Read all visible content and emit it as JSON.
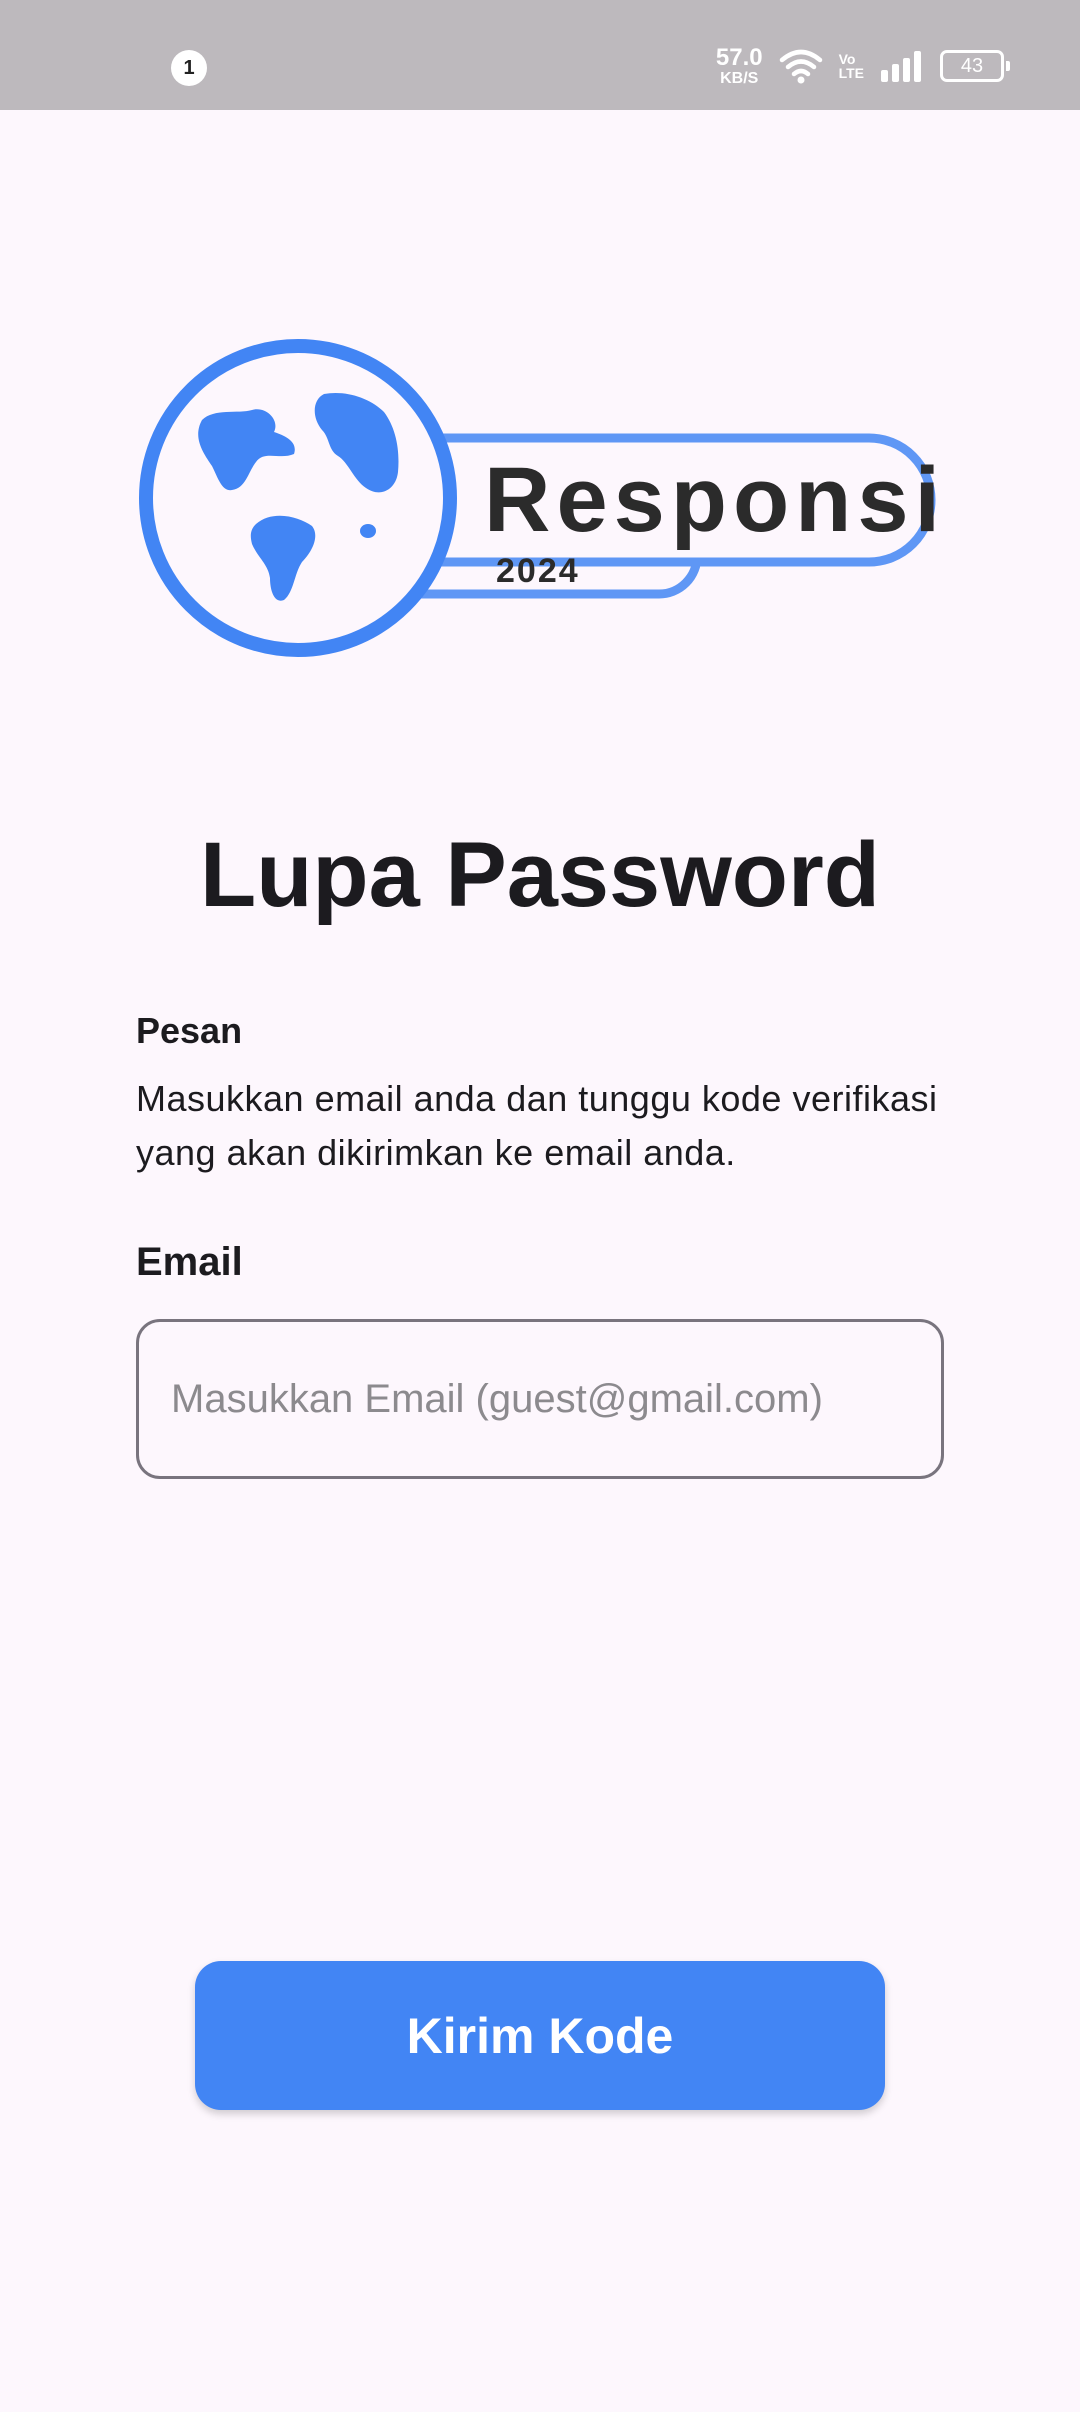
{
  "status_bar": {
    "notification_count": "1",
    "network_speed_value": "57.0",
    "network_speed_unit": "KB/S",
    "volte_top": "Vo",
    "volte_bottom": "LTE",
    "battery_level": "43",
    "icons": [
      "wifi-icon",
      "signal-icon",
      "battery-icon"
    ]
  },
  "logo": {
    "name": "Responsi",
    "year": "2024",
    "icon": "globe-icon",
    "colors": {
      "primary": "#4285f4",
      "light": "#5f97f5",
      "text": "#2b2b2b"
    }
  },
  "page": {
    "title": "Lupa Password"
  },
  "message": {
    "label": "Pesan",
    "text": "Masukkan email anda dan tunggu kode verifikasi yang akan dikirimkan ke email anda."
  },
  "email": {
    "label": "Email",
    "value": "",
    "placeholder": "Masukkan Email (guest@gmail.com)"
  },
  "actions": {
    "send_label": "Kirim Kode"
  },
  "theme": {
    "background": "#fdf7fd",
    "accent": "#4285f4"
  }
}
